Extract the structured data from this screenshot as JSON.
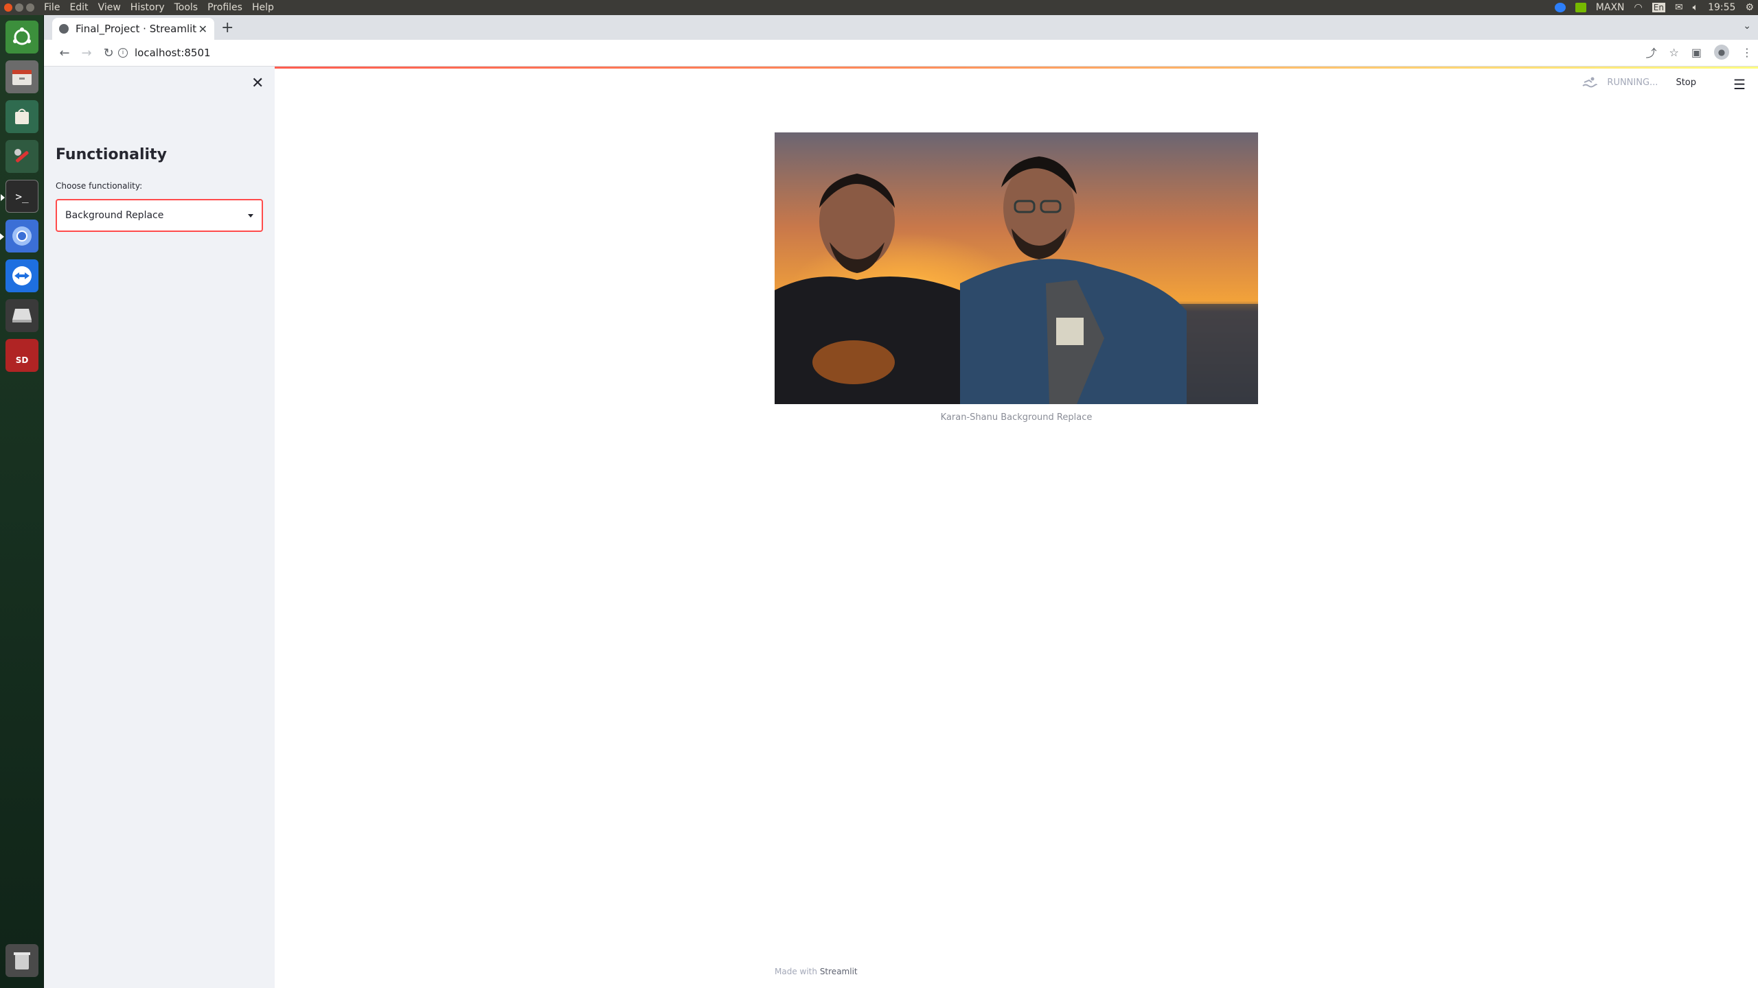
{
  "os": {
    "menu": [
      "File",
      "Edit",
      "View",
      "History",
      "Tools",
      "Profiles",
      "Help"
    ],
    "tray": {
      "power_mode": "MAXN",
      "keyboard": "En",
      "clock": "19:55"
    }
  },
  "browser": {
    "tab_title": "Final_Project · Streamlit",
    "url": "localhost:8501"
  },
  "sidebar": {
    "title": "Functionality",
    "select_label": "Choose functionality:",
    "select_value": "Background Replace"
  },
  "header": {
    "status": "RUNNING...",
    "stop_label": "Stop"
  },
  "main": {
    "image_caption": "Karan-Shanu Background Replace"
  },
  "footer": {
    "prefix": "Made with",
    "brand": "Streamlit"
  },
  "colors": {
    "accent": "#ff4b4b",
    "sidebar_bg": "#f0f2f6",
    "ubuntu_orange": "#e95420"
  }
}
